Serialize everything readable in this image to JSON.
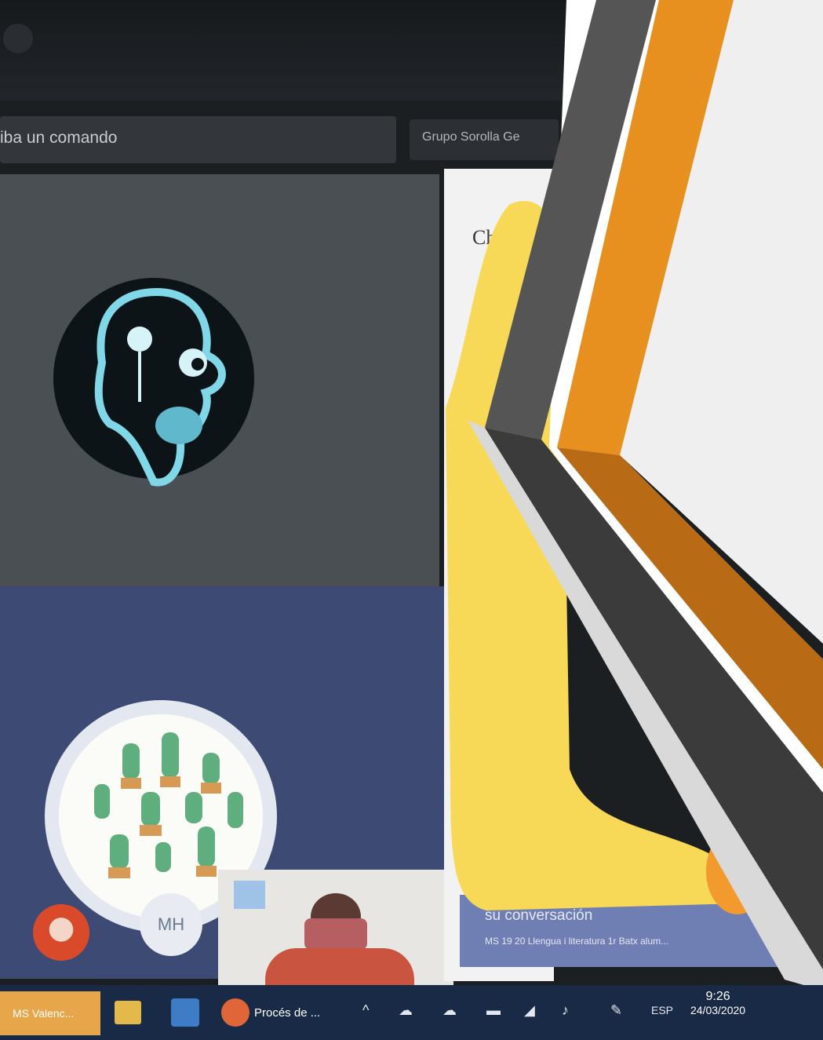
{
  "command_bar": {
    "placeholder": "iba un comando"
  },
  "team_tab": {
    "label": "Grupo Sorolla Ge"
  },
  "chat": {
    "title": "Ch"
  },
  "participants": {
    "initials": "MH"
  },
  "notification": {
    "line1": "su conversación",
    "line2": "MS 19 20 Llengua i literatura 1r Batx alum..."
  },
  "taskbar": {
    "items": [
      "MS Valenc...",
      "Procés de ..."
    ],
    "language": "ESP",
    "time": "9:26",
    "date": "24/03/2020"
  },
  "overlay": {
    "stripe_colors": {
      "dark": "#3d3d3d",
      "orange": "#e8901f",
      "dark_shadow": "#2b2b2b",
      "orange_shadow": "#b86a14",
      "panel": "#efefef",
      "highlight": "#f8d957"
    }
  },
  "icons": [
    "x-ray-head-avatar-icon",
    "cactus-avatar-icon",
    "files-icon",
    "word-icon",
    "powerpoint-icon",
    "chevron-up-icon",
    "onedrive-icon",
    "network-icon",
    "volume-icon"
  ]
}
